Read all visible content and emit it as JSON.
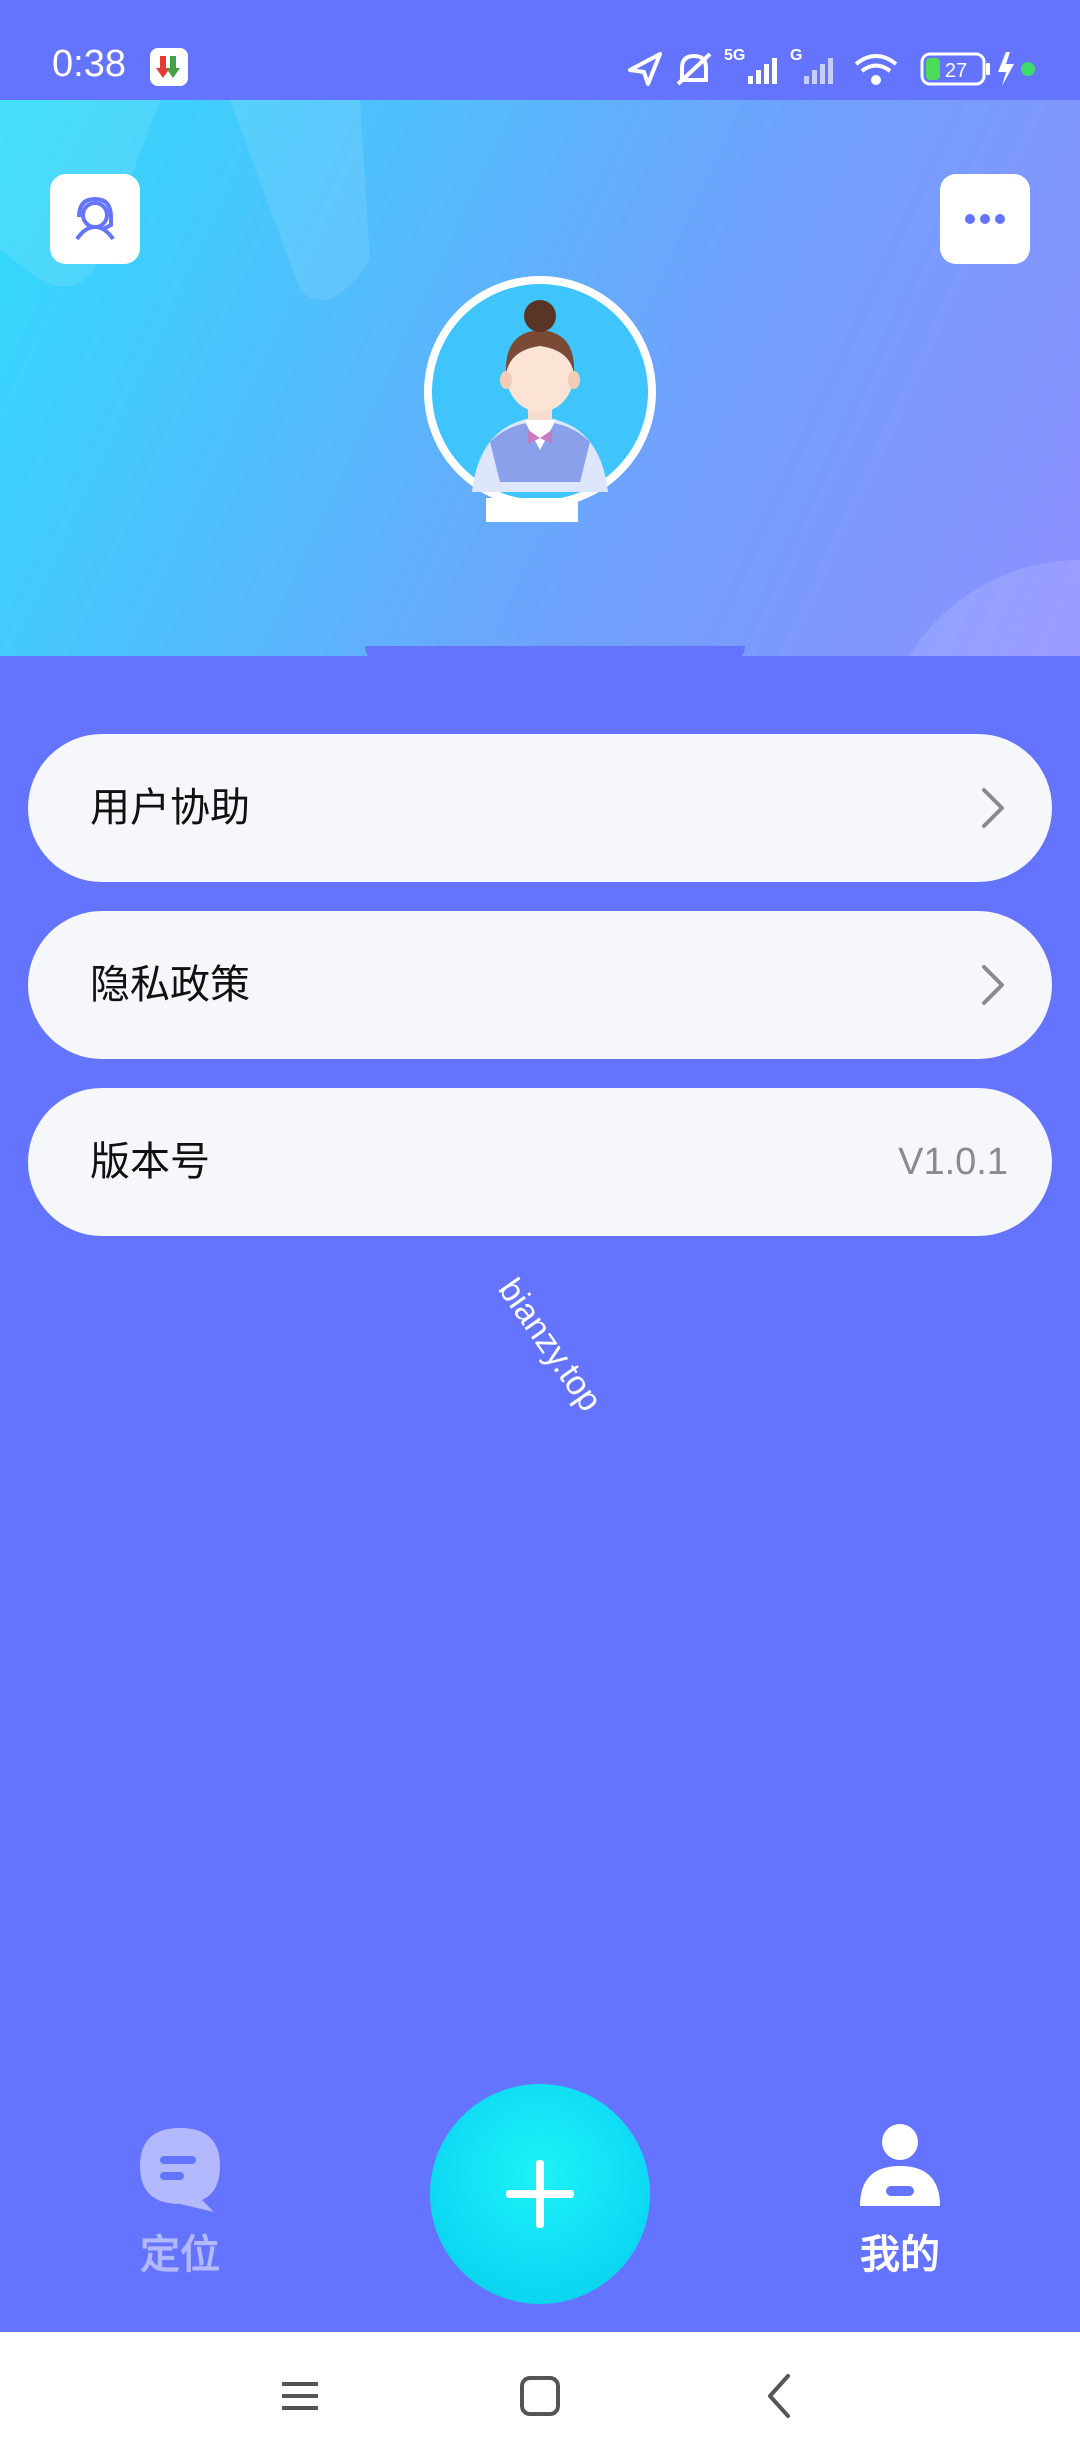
{
  "status_bar": {
    "time": "0:38",
    "battery": "27",
    "network_1": "5G",
    "network_2": "G"
  },
  "header": {
    "support_icon": "headset-person-icon",
    "more_icon": "more-dots-icon",
    "avatar_icon": "customer-service-avatar"
  },
  "menu": {
    "items": [
      {
        "label": "用户协助",
        "icon": "chevron-right-icon"
      },
      {
        "label": "隐私政策",
        "icon": "chevron-right-icon"
      },
      {
        "label": "版本号",
        "value": "V1.0.1"
      }
    ]
  },
  "watermark": "bianzy.top",
  "bottom_nav": {
    "items": [
      {
        "label": "定位",
        "icon": "chat-bubble-icon",
        "active": false
      },
      {
        "label": "我的",
        "icon": "person-icon",
        "active": true
      }
    ],
    "fab_icon": "plus-icon"
  },
  "colors": {
    "background": "#6574fe",
    "card": "#f6f7fb",
    "fab": "#0edbf4",
    "nav_inactive": "#b3b9ff",
    "nav_active": "#ffffff"
  }
}
